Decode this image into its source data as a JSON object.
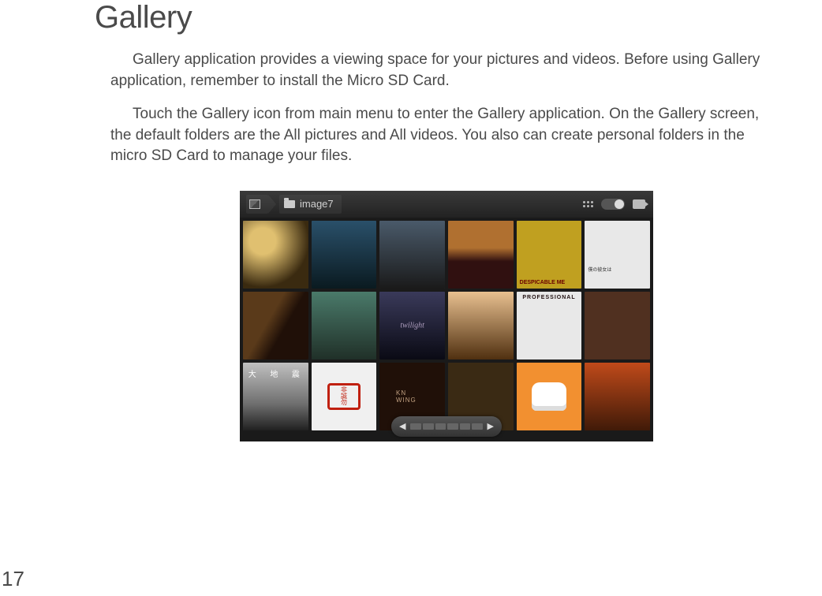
{
  "title": "Gallery",
  "paragraphs": [
    "Gallery application provides a viewing space for your pictures and videos. Before using Gallery application, remember to install the Micro SD Card.",
    "Touch the Gallery icon from main menu to enter the Gallery application. On the Gallery screen, the default folders are the All pictures and All videos. You also can create personal folders in the micro SD Card to manage your files."
  ],
  "screenshot": {
    "breadcrumb_folder": "image7",
    "thumb_labels": {
      "t5": "DESPICABLE ME",
      "t6": "僕の彼女は",
      "t9": "twilight",
      "t11": "PROFESSIONAL",
      "t13": "大  地  震",
      "t15": "KN   WING"
    }
  },
  "page_number": "17"
}
